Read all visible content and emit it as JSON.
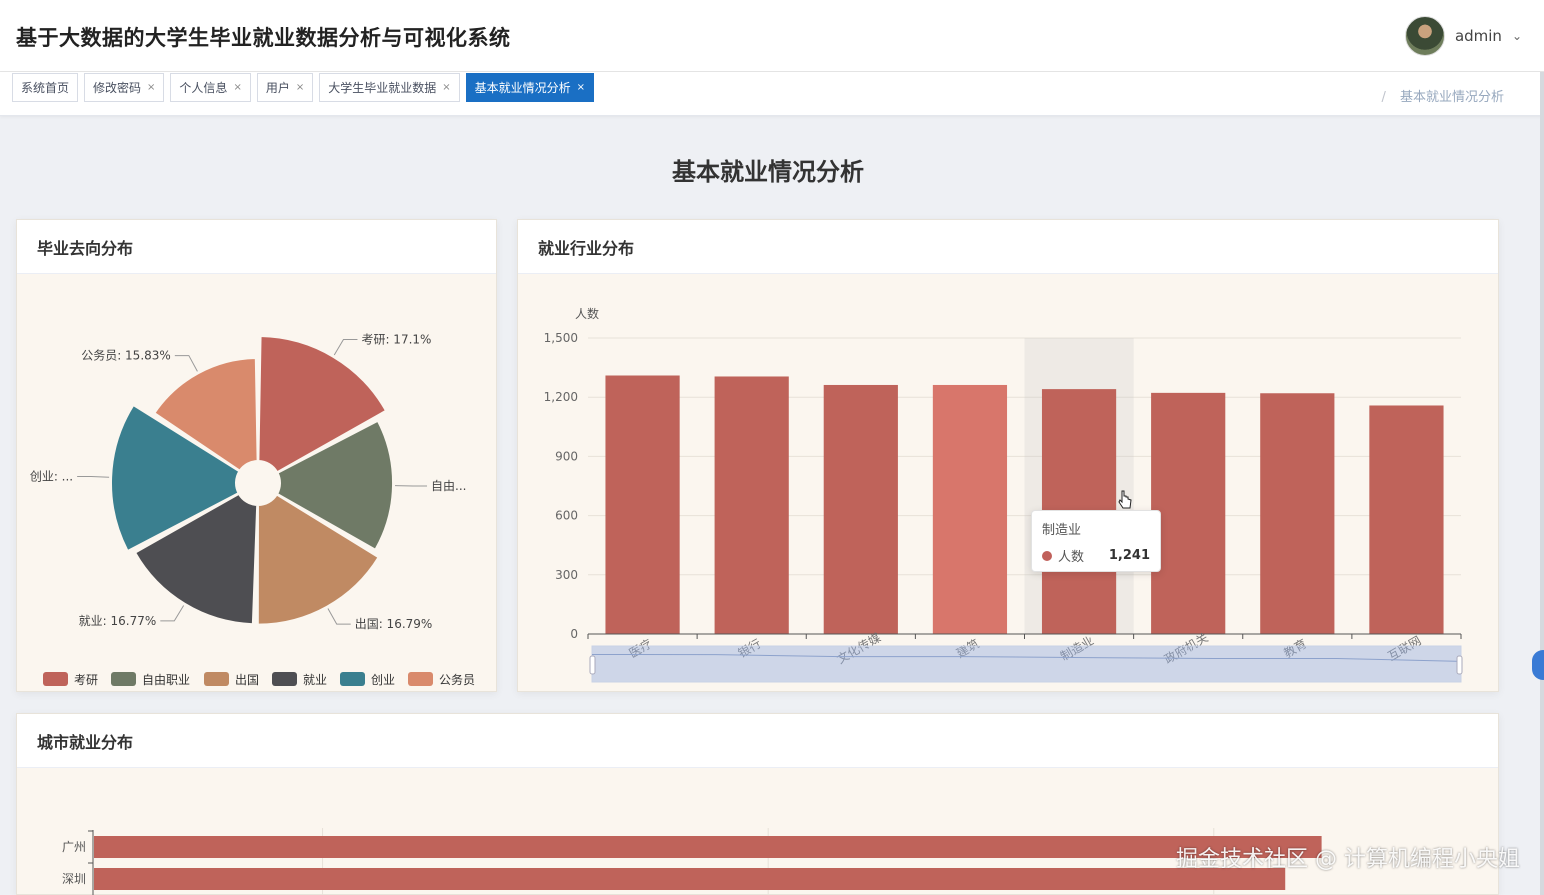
{
  "header": {
    "title": "基于大数据的大学生毕业就业数据分析与可视化系统",
    "username": "admin"
  },
  "tags": [
    {
      "label": "系统首页",
      "closable": false,
      "active": false
    },
    {
      "label": "修改密码",
      "closable": true,
      "active": false
    },
    {
      "label": "个人信息",
      "closable": true,
      "active": false
    },
    {
      "label": "用户",
      "closable": true,
      "active": false
    },
    {
      "label": "大学生毕业就业数据",
      "closable": true,
      "active": false
    },
    {
      "label": "基本就业情况分析",
      "closable": true,
      "active": true
    }
  ],
  "tag_close_glyph": "×",
  "breadcrumb": {
    "separator": "/",
    "current": "基本就业情况分析"
  },
  "page": {
    "heading": "基本就业情况分析"
  },
  "cards": {
    "pie_title": "毕业去向分布",
    "bar_title": "就业行业分布",
    "city_title": "城市就业分布"
  },
  "colors": {
    "active_tag": "#1a6fc4",
    "bar": "#bf635a",
    "bar_highlight": "#d8766b"
  },
  "chart_data": [
    {
      "type": "pie",
      "subtype": "rose",
      "slices": [
        {
          "name": "考研",
          "value": 17.1,
          "color": "#bf635a",
          "label": "考研: 17.1%"
        },
        {
          "name": "自由职业",
          "value": 16.41,
          "color": "#6f7a66",
          "label": "自由..."
        },
        {
          "name": "出国",
          "value": 16.79,
          "color": "#c08a63",
          "label": "出国: 16.79%"
        },
        {
          "name": "就业",
          "value": 16.77,
          "color": "#4e4e52",
          "label": "就业: 16.77%"
        },
        {
          "name": "创业",
          "value": 17.1,
          "color": "#3a7f8f",
          "label": "创业: ..."
        },
        {
          "name": "公务员",
          "value": 15.83,
          "color": "#d98a6c",
          "label": "公务员: 15.83%"
        }
      ],
      "legend": [
        "考研",
        "自由职业",
        "出国",
        "就业",
        "创业",
        "公务员"
      ],
      "legend_position": "bottom"
    },
    {
      "type": "bar",
      "ylabel": "人数",
      "categories": [
        "医疗",
        "银行",
        "文化传媒",
        "建筑",
        "制造业",
        "政府机关",
        "教育",
        "互联网"
      ],
      "values": [
        1310,
        1305,
        1262,
        1262,
        1241,
        1222,
        1220,
        1158
      ],
      "ylim": [
        0,
        1500
      ],
      "yticks": [
        "0",
        "300",
        "600",
        "900",
        "1,200",
        "1,500"
      ],
      "grid": true,
      "highlighted": "制造业",
      "hovered_index": 3,
      "datazoom": true,
      "tooltip": {
        "title": "制造业",
        "series": "人数",
        "value": "1,241"
      }
    },
    {
      "type": "bar",
      "orientation": "horizontal",
      "categories": [
        "广州",
        "深圳"
      ],
      "values": [
        1350,
        1310
      ],
      "xlim": [
        0,
        1500
      ],
      "partially_visible": true
    }
  ],
  "watermark": "掘金技术社区 @ 计算机编程小央姐"
}
